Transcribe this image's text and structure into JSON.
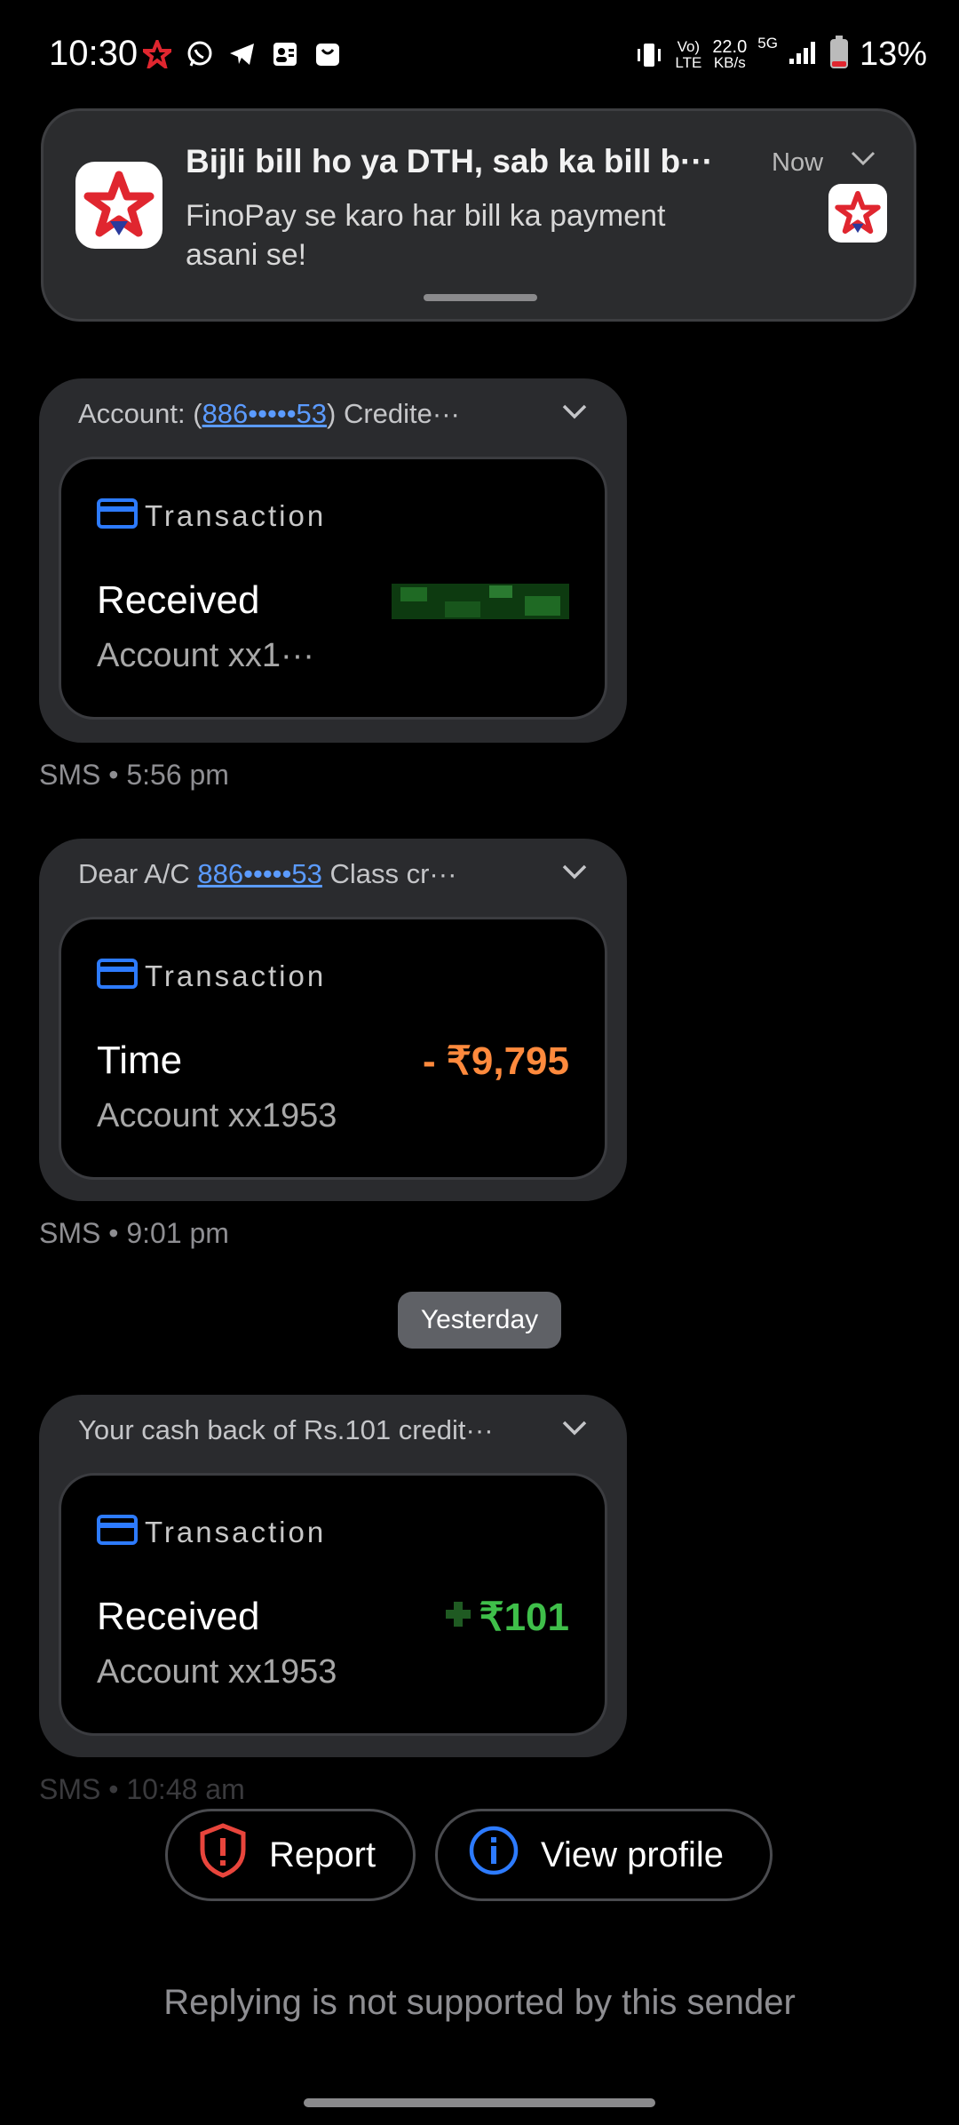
{
  "status_bar": {
    "time": "10:30",
    "net_line1": "Vo)",
    "net_line2": "LTE",
    "speed_value": "22.0",
    "speed_unit": "KB/s",
    "network": "5G",
    "battery": "13%"
  },
  "notification": {
    "title": "Bijli bill ho ya DTH, sab ka bill b···",
    "body": "FinoPay se karo har bill ka payment asani se!",
    "time": "Now"
  },
  "messages": [
    {
      "header_pre": "Account: (",
      "header_link": "886•••••53",
      "header_post": ") Credite···",
      "tag": "Transaction",
      "label": "Received",
      "account": "Account xx1···",
      "amount": "",
      "amount_color": "#3aa83a",
      "meta": "SMS • 5:56 pm"
    },
    {
      "header_pre": "Dear A/C ",
      "header_link": "886•••••53",
      "header_post": " Class cr···",
      "tag": "Transaction",
      "label": "Time",
      "account": "Account xx1953",
      "amount": "- ₹9,795",
      "amount_color": "#ff8a3d",
      "meta": "SMS • 9:01 pm"
    },
    {
      "header_pre": "Your cash back of Rs.101 credit···",
      "header_link": "",
      "header_post": "",
      "tag": "Transaction",
      "label": "Received",
      "account": "Account xx1953",
      "amount": "₹101",
      "amount_color": "#3fbf4a",
      "meta": "SMS • 10:48 am"
    }
  ],
  "date_divider": "Yesterday",
  "actions": {
    "report": "Report",
    "view_profile": "View profile"
  },
  "footer": "Replying is not supported by this sender",
  "colors": {
    "accent_blue": "#2d7bff",
    "report_red": "#e8453c"
  }
}
